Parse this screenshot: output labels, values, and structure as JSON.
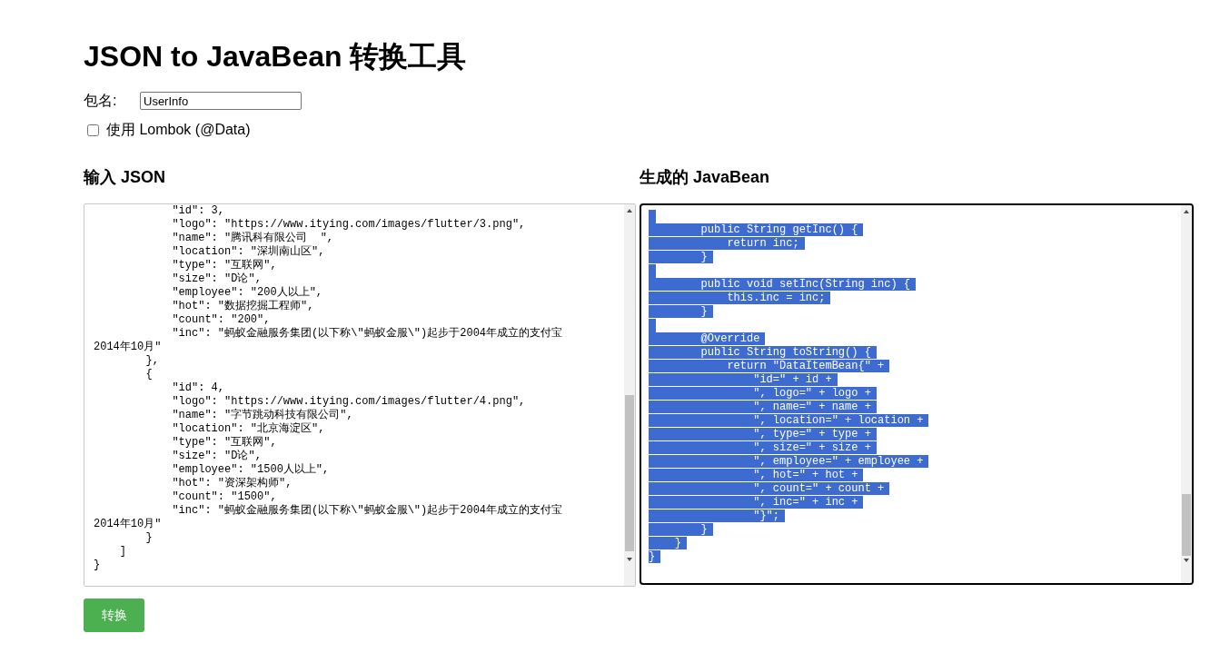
{
  "title": "JSON to JavaBean 转换工具",
  "package": {
    "label": "包名:",
    "value": "UserInfo"
  },
  "lombok": {
    "label": "使用 Lombok (@Data)",
    "checked": false
  },
  "input": {
    "heading": "输入 JSON",
    "lines": [
      {
        "kind": "code",
        "text": "            \"id\": 3,"
      },
      {
        "kind": "code",
        "text": "            \"logo\": \"https://www.itying.com/images/flutter/3.png\","
      },
      {
        "kind": "code",
        "text": "            \"name\": \"腾讯科有限公司  \","
      },
      {
        "kind": "code",
        "text": "            \"location\": \"深圳南山区\","
      },
      {
        "kind": "code",
        "text": "            \"type\": \"互联网\","
      },
      {
        "kind": "code",
        "text": "            \"size\": \"D论\","
      },
      {
        "kind": "code",
        "text": "            \"employee\": \"200人以上\","
      },
      {
        "kind": "code",
        "text": "            \"hot\": \"数据挖掘工程师\","
      },
      {
        "kind": "code",
        "text": "            \"count\": \"200\","
      },
      {
        "kind": "code",
        "text": "            \"inc\": \"蚂蚁金融服务集团(以下称\\\"蚂蚁金服\\\")起步于2004年成立的支付宝"
      },
      {
        "kind": "code",
        "text": "2014年10月\""
      },
      {
        "kind": "code",
        "text": "        },"
      },
      {
        "kind": "code",
        "text": "        {"
      },
      {
        "kind": "code",
        "text": "            \"id\": 4,"
      },
      {
        "kind": "code",
        "text": "            \"logo\": \"https://www.itying.com/images/flutter/4.png\","
      },
      {
        "kind": "code",
        "text": "            \"name\": \"字节跳动科技有限公司\","
      },
      {
        "kind": "code",
        "text": "            \"location\": \"北京海淀区\","
      },
      {
        "kind": "code",
        "text": "            \"type\": \"互联网\","
      },
      {
        "kind": "code",
        "text": "            \"size\": \"D论\","
      },
      {
        "kind": "code",
        "text": "            \"employee\": \"1500人以上\","
      },
      {
        "kind": "code",
        "text": "            \"hot\": \"资深架构师\","
      },
      {
        "kind": "code",
        "text": "            \"count\": \"1500\","
      },
      {
        "kind": "code",
        "text": "            \"inc\": \"蚂蚁金融服务集团(以下称\\\"蚂蚁金服\\\")起步于2004年成立的支付宝"
      },
      {
        "kind": "code",
        "text": "2014年10月\""
      },
      {
        "kind": "code",
        "text": "        }"
      },
      {
        "kind": "code",
        "text": "    ]"
      },
      {
        "kind": "code",
        "text": "}"
      }
    ]
  },
  "output": {
    "heading": "生成的 JavaBean",
    "selected": true,
    "lines": [
      {
        "kind": "blank"
      },
      {
        "kind": "code",
        "text": "        public String getInc() {"
      },
      {
        "kind": "code",
        "text": "            return inc;"
      },
      {
        "kind": "code",
        "text": "        }"
      },
      {
        "kind": "blank"
      },
      {
        "kind": "code",
        "text": "        public void setInc(String inc) {"
      },
      {
        "kind": "code",
        "text": "            this.inc = inc;"
      },
      {
        "kind": "code",
        "text": "        }"
      },
      {
        "kind": "blank"
      },
      {
        "kind": "code",
        "text": "        @Override"
      },
      {
        "kind": "code",
        "text": "        public String toString() {"
      },
      {
        "kind": "code",
        "text": "            return \"DataItemBean{\" +"
      },
      {
        "kind": "code",
        "text": "                \"id=\" + id +"
      },
      {
        "kind": "code",
        "text": "                \", logo=\" + logo +"
      },
      {
        "kind": "code",
        "text": "                \", name=\" + name +"
      },
      {
        "kind": "code",
        "text": "                \", location=\" + location +"
      },
      {
        "kind": "code",
        "text": "                \", type=\" + type +"
      },
      {
        "kind": "code",
        "text": "                \", size=\" + size +"
      },
      {
        "kind": "code",
        "text": "                \", employee=\" + employee +"
      },
      {
        "kind": "code",
        "text": "                \", hot=\" + hot +"
      },
      {
        "kind": "code",
        "text": "                \", count=\" + count +"
      },
      {
        "kind": "code",
        "text": "                \", inc=\" + inc +"
      },
      {
        "kind": "code",
        "text": "                \"}\";"
      },
      {
        "kind": "code",
        "text": "        }"
      },
      {
        "kind": "code",
        "text": "    }"
      },
      {
        "kind": "code",
        "text": "}"
      }
    ]
  },
  "button": {
    "label": "转换"
  }
}
